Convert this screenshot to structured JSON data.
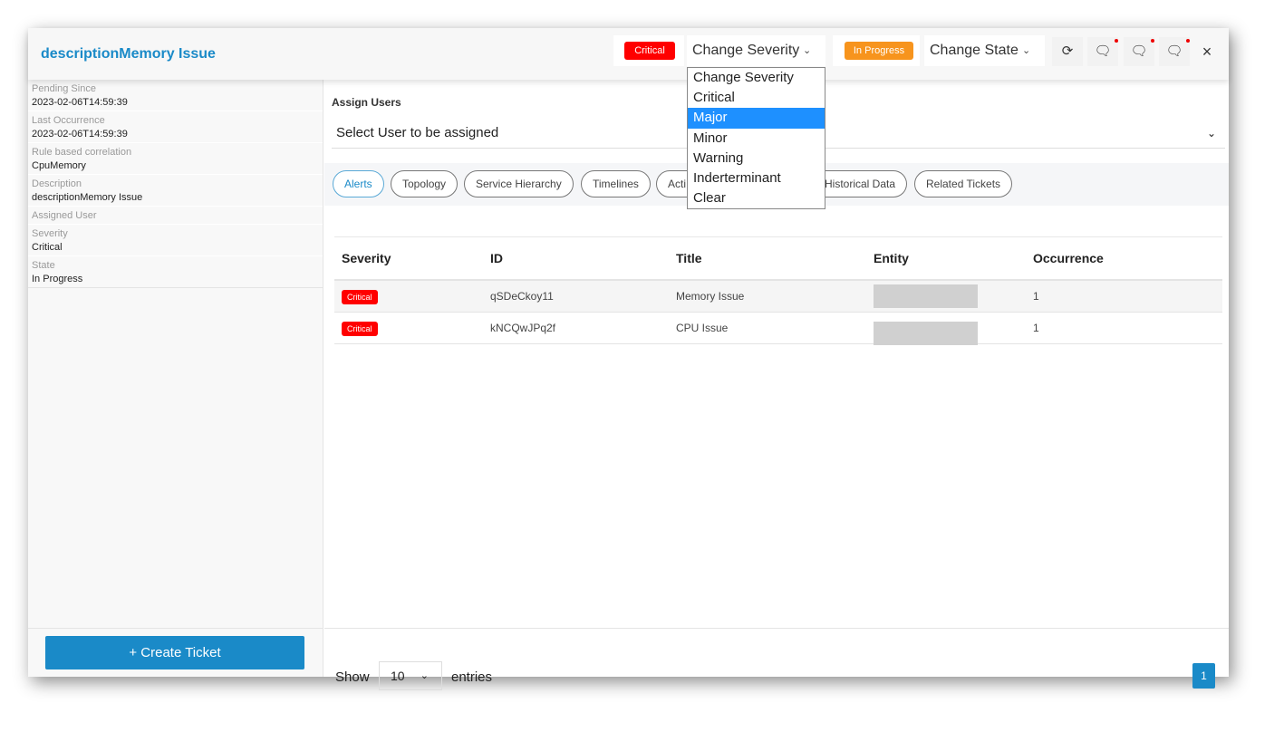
{
  "header": {
    "title": "descriptionMemory Issue",
    "severity_badge": "Critical",
    "change_severity": "Change Severity",
    "state_badge": "In Progress",
    "change_state": "Change State",
    "close": "×",
    "colors": {
      "critical": "#ff0000",
      "in_progress": "#f7941d",
      "accent": "#1a8ac8"
    }
  },
  "severity_dropdown": {
    "options": [
      "Change Severity",
      "Critical",
      "Major",
      "Minor",
      "Warning",
      "Inderterminant",
      "Clear"
    ],
    "highlighted": "Major"
  },
  "sidebar": {
    "fields": [
      {
        "label": "Pending Since",
        "value": "2023-02-06T14:59:39"
      },
      {
        "label": "Last Occurrence",
        "value": "2023-02-06T14:59:39"
      },
      {
        "label": "Rule based correlation",
        "value": "CpuMemory"
      },
      {
        "label": "Description",
        "value": "descriptionMemory Issue"
      },
      {
        "label": "Assigned User",
        "value": ""
      },
      {
        "label": "Severity",
        "value": "Critical"
      },
      {
        "label": "State",
        "value": "In Progress"
      }
    ],
    "create_ticket": "+ Create Ticket"
  },
  "assign": {
    "label": "Assign Users",
    "placeholder": "Select User to be assigned"
  },
  "tabs": [
    "Alerts",
    "Topology",
    "Service Hierarchy",
    "Timelines",
    "Acti",
    "Historical Data",
    "Related Tickets"
  ],
  "table": {
    "headers": [
      "Severity",
      "ID",
      "Title",
      "Entity",
      "Occurrence"
    ],
    "rows": [
      {
        "severity": "Critical",
        "id": "qSDeCkoy11",
        "title": "Memory Issue",
        "occurrence": "1"
      },
      {
        "severity": "Critical",
        "id": "kNCQwJPq2f",
        "title": "CPU Issue",
        "occurrence": "1"
      }
    ]
  },
  "footer": {
    "show": "Show",
    "page_size": "10",
    "entries": "entries",
    "page": "1"
  }
}
